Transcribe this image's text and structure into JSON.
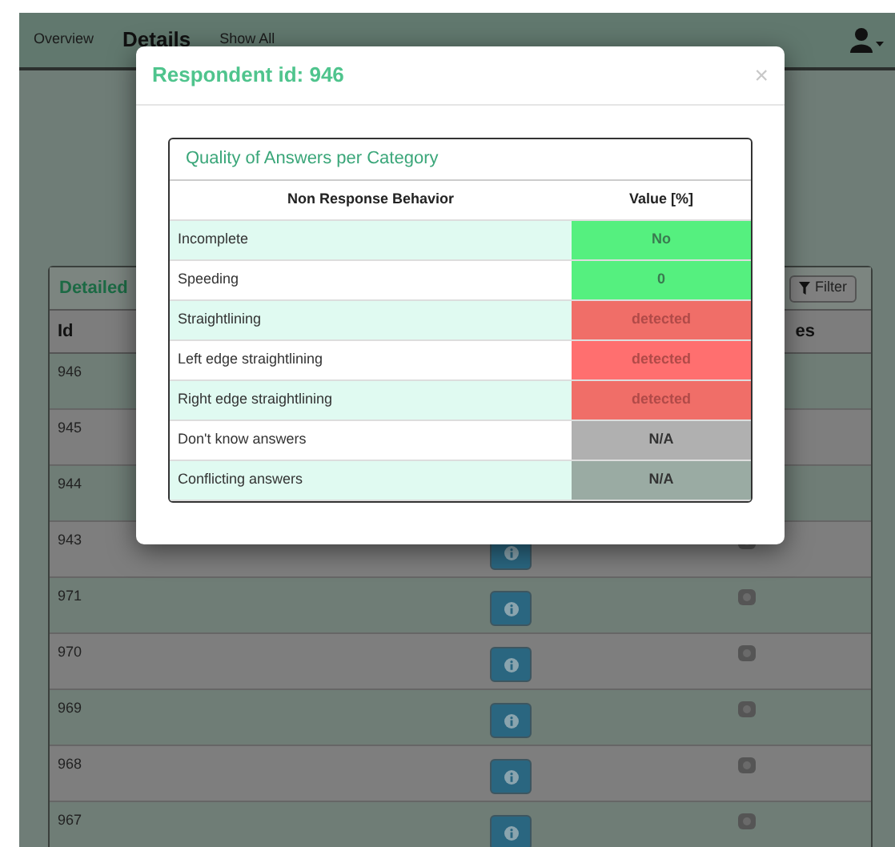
{
  "navbar": {
    "tabs": [
      {
        "label": "Overview",
        "selected": false
      },
      {
        "label": "Details",
        "selected": true
      },
      {
        "label": "Show All",
        "selected": false
      }
    ]
  },
  "panel": {
    "title": "Detailed",
    "filter_button": "Filter",
    "columns": [
      "Id",
      "es"
    ],
    "rows": [
      {
        "id": "946"
      },
      {
        "id": "945"
      },
      {
        "id": "944"
      },
      {
        "id": "943"
      },
      {
        "id": "971"
      },
      {
        "id": "970"
      },
      {
        "id": "969"
      },
      {
        "id": "968"
      },
      {
        "id": "967"
      }
    ]
  },
  "modal": {
    "title": "Respondent id: 946",
    "close": "×",
    "table": {
      "title": "Quality of Answers per Category",
      "columns": [
        "Non Response Behavior",
        "Value [%]"
      ],
      "rows": [
        {
          "label": "Incomplete",
          "value": "No",
          "kind": "ok"
        },
        {
          "label": "Speeding",
          "value": "0",
          "kind": "ok"
        },
        {
          "label": "Straightlining",
          "value": "detected",
          "kind": "detected"
        },
        {
          "label": "Left edge straightlining",
          "value": "detected",
          "kind": "detected"
        },
        {
          "label": "Right edge straightlining",
          "value": "detected",
          "kind": "detected"
        },
        {
          "label": "Don't know answers",
          "value": "N/A",
          "kind": "na"
        },
        {
          "label": "Conflicting answers",
          "value": "N/A",
          "kind": "na"
        }
      ]
    }
  }
}
